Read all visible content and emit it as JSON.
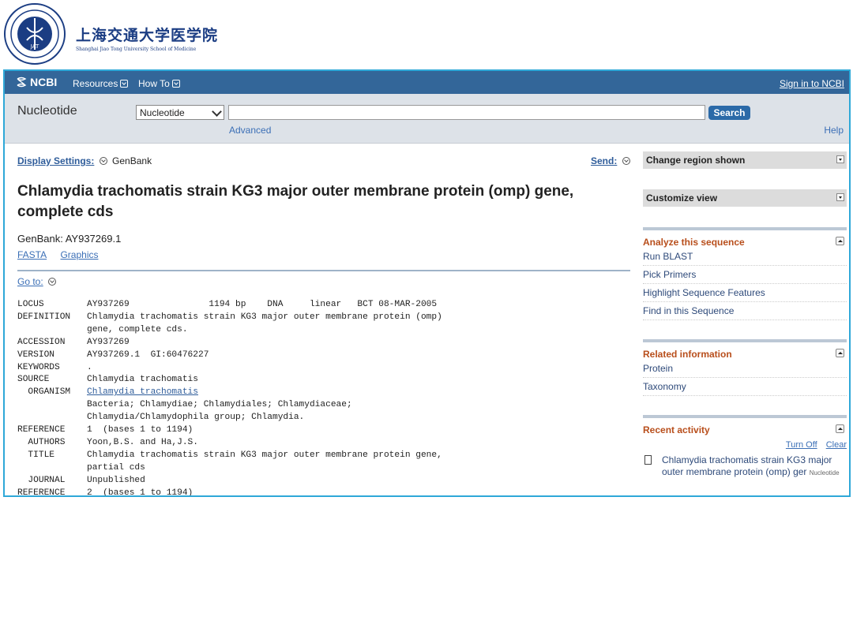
{
  "school": {
    "name_cn": "上海交通大学医学院",
    "name_en": "Shanghai Jiao Tong University School of Medicine",
    "seal_text": "JAT"
  },
  "ncbi": {
    "brand": "NCBI",
    "menu": [
      "Resources",
      "How To"
    ],
    "signin": "Sign in to NCBI"
  },
  "search": {
    "db_title": "Nucleotide",
    "db_selected": "Nucleotide",
    "query_value": "",
    "button": "Search",
    "advanced": "Advanced",
    "help": "Help"
  },
  "record": {
    "display_settings_label": "Display Settings:",
    "display_format": "GenBank",
    "send_label": "Send:",
    "title": "Chlamydia trachomatis strain KG3 major outer membrane protein (omp) gene, complete cds",
    "accession_line": "GenBank: AY937269.1",
    "format_links": [
      "FASTA",
      "Graphics"
    ],
    "goto_label": "Go to:",
    "flatfile": [
      {
        "key": "LOCUS",
        "value": "AY937269               1194 bp    DNA     linear   BCT 08-MAR-2005"
      },
      {
        "key": "DEFINITION",
        "value": "Chlamydia trachomatis strain KG3 major outer membrane protein (omp)"
      },
      {
        "key": "",
        "value": "gene, complete cds."
      },
      {
        "key": "ACCESSION",
        "value": "AY937269"
      },
      {
        "key": "VERSION",
        "value": "AY937269.1  GI:60476227"
      },
      {
        "key": "KEYWORDS",
        "value": "."
      },
      {
        "key": "SOURCE",
        "value": "Chlamydia trachomatis"
      },
      {
        "key": "  ORGANISM",
        "value": "Chlamydia trachomatis",
        "link": true
      },
      {
        "key": "",
        "value": "Bacteria; Chlamydiae; Chlamydiales; Chlamydiaceae;"
      },
      {
        "key": "",
        "value": "Chlamydia/Chlamydophila group; Chlamydia."
      },
      {
        "key": "REFERENCE",
        "value": "1  (bases 1 to 1194)"
      },
      {
        "key": "  AUTHORS",
        "value": "Yoon,B.S. and Ha,J.S."
      },
      {
        "key": "  TITLE",
        "value": "Chlamydia trachomatis strain KG3 major outer membrane protein gene,"
      },
      {
        "key": "",
        "value": "partial cds"
      },
      {
        "key": "  JOURNAL",
        "value": "Unpublished"
      },
      {
        "key": "REFERENCE",
        "value": "2  (bases 1 to 1194)"
      }
    ]
  },
  "sidebar": {
    "change_region": "Change region shown",
    "customize_view": "Customize view",
    "analyze": {
      "title": "Analyze this sequence",
      "items": [
        "Run BLAST",
        "Pick Primers",
        "Highlight Sequence Features",
        "Find in this Sequence"
      ]
    },
    "related": {
      "title": "Related information",
      "items": [
        "Protein",
        "Taxonomy"
      ]
    },
    "recent": {
      "title": "Recent activity",
      "turn_off": "Turn Off",
      "clear": "Clear",
      "item_text": "Chlamydia trachomatis strain KG3 major outer membrane protein (omp) ger",
      "item_tag": "Nucleotide"
    }
  },
  "colors": {
    "ncbi_bar": "#336699",
    "frame": "#2ea8d8",
    "search_bg": "#dde2e8",
    "portlet_head": "#b84e1b"
  }
}
